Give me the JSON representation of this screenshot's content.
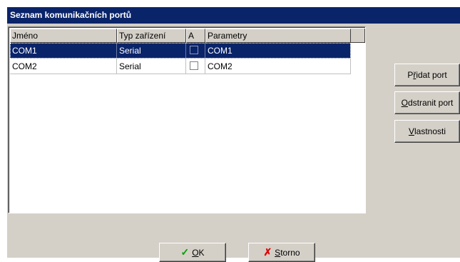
{
  "dialog": {
    "title": "Seznam komunikačních portů"
  },
  "list": {
    "columns": [
      {
        "label": "Jméno"
      },
      {
        "label": "Typ zařízení"
      },
      {
        "label": "A"
      },
      {
        "label": "Parametry"
      }
    ],
    "rows": [
      {
        "name": "COM1",
        "type": "Serial",
        "active": false,
        "params": "COM1",
        "selected": true
      },
      {
        "name": "COM2",
        "type": "Serial",
        "active": false,
        "params": "COM2",
        "selected": false
      }
    ]
  },
  "buttons": {
    "add_pre": "P",
    "add_ul": "ř",
    "add_post": "idat port",
    "remove_pre": "",
    "remove_ul": "O",
    "remove_post": "dstranit port",
    "props_pre": "",
    "props_ul": "V",
    "props_post": "lastnosti",
    "ok_pre": "",
    "ok_ul": "O",
    "ok_post": "K",
    "cancel_pre": "",
    "cancel_ul": "S",
    "cancel_post": "torno"
  },
  "icons": {
    "ok": "checkmark-icon",
    "cancel": "x-icon"
  },
  "colors": {
    "title_bg": "#0a246a",
    "selection_bg": "#0a246a",
    "face": "#d4d0c8"
  }
}
